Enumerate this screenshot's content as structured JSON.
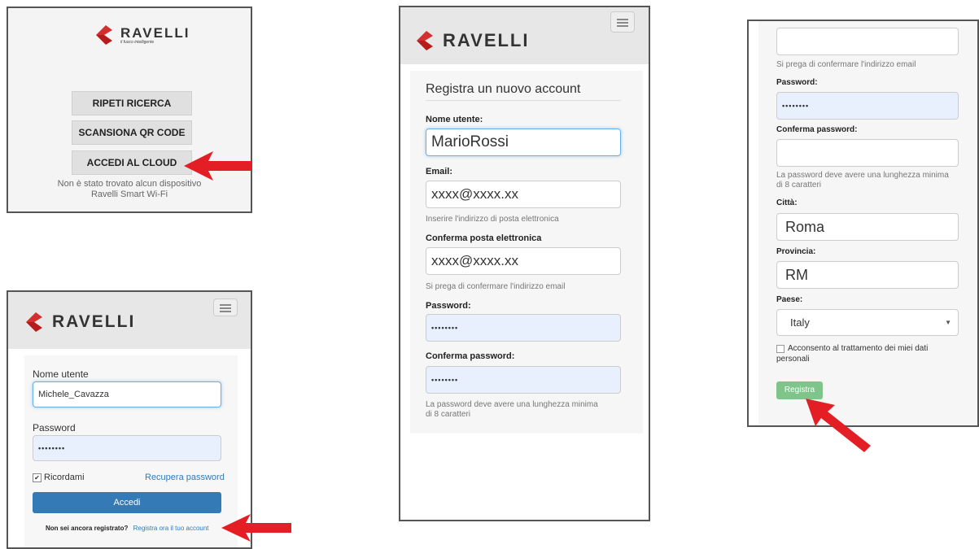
{
  "brand": {
    "name": "RAVELLI",
    "tagline": "il fuoco intelligente"
  },
  "panel_search": {
    "btn_repeat": "RIPETI RICERCA",
    "btn_qr": "SCANSIONA QR CODE",
    "btn_cloud": "ACCEDI AL CLOUD",
    "status_line1": "Non è stato trovato alcun dispositivo",
    "status_line2": "Ravelli Smart Wi-Fi"
  },
  "panel_login": {
    "username_label": "Nome utente",
    "username_value": "Michele_Cavazza",
    "password_label": "Password",
    "password_value": "••••••••",
    "remember_label": "Ricordami",
    "recover_link": "Recupera password",
    "login_button": "Accedi",
    "not_registered": "Non sei ancora registrato?",
    "register_link": "Registra ora il tuo account"
  },
  "panel_register": {
    "title": "Registra un nuovo account",
    "username_label": "Nome utente:",
    "username_value": "MarioRossi",
    "email_label": "Email:",
    "email_value": "xxxx@xxxx.xx",
    "email_help": "Inserire l'indirizzo di posta elettronica",
    "confirm_email_label": "Conferma posta elettronica",
    "confirm_email_value": "xxxx@xxxx.xx",
    "confirm_email_help": "Si prega di confermare l'indirizzo email",
    "password_label": "Password:",
    "password_value": "••••••••",
    "confirm_password_label": "Conferma password:",
    "confirm_password_value": "••••••••",
    "password_help_1": "La password deve avere una lunghezza minima",
    "password_help_2": "di 8 caratteri"
  },
  "panel_register_cont": {
    "confirm_email_help": "Si prega di confermare l'indirizzo email",
    "password_label": "Password:",
    "password_value": "••••••••",
    "confirm_password_label": "Conferma password:",
    "password_help_1": "La password deve avere una lunghezza minima",
    "password_help_2": "di 8 caratteri",
    "city_label": "Città:",
    "city_value": "Roma",
    "province_label": "Provincia:",
    "province_value": "RM",
    "country_label": "Paese:",
    "country_value": "Italy",
    "consent_line1": "Acconsento al trattamento dei miei dati",
    "consent_line2": "personali",
    "register_button": "Registra"
  },
  "colors": {
    "accent_red": "#e31e24",
    "link_blue": "#337ab7",
    "primary_btn": "#337ab7",
    "success_btn": "#7fc48a",
    "logo_red": "#d32f2f"
  }
}
